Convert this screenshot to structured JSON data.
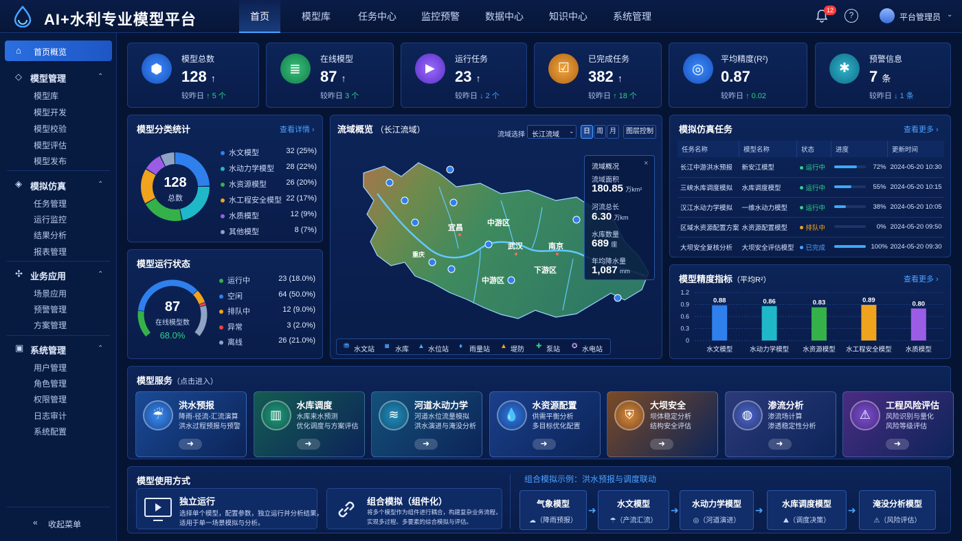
{
  "app": {
    "title": "AI+水利专业模型平台"
  },
  "nav": [
    "首页",
    "模型库",
    "任务中心",
    "监控预警",
    "数据中心",
    "知识中心",
    "系统管理"
  ],
  "header": {
    "notification_count": "12",
    "help": "?",
    "user": "平台管理员",
    "user_chevron": "⌄"
  },
  "sidebar": {
    "active": "首页概览",
    "groups": [
      {
        "label": "模型管理",
        "items": [
          "模型库",
          "模型开发",
          "模型校验",
          "模型评估",
          "模型发布"
        ]
      },
      {
        "label": "模拟仿真",
        "items": [
          "任务管理",
          "运行监控",
          "结果分析",
          "报表管理"
        ]
      },
      {
        "label": "业务应用",
        "items": [
          "场景应用",
          "预警管理",
          "方案管理"
        ]
      },
      {
        "label": "系统管理",
        "items": [
          "用户管理",
          "角色管理",
          "权限管理",
          "日志审计",
          "系统配置"
        ]
      }
    ],
    "collapse": "收起菜单"
  },
  "stats": [
    {
      "label": "模型总数",
      "value": "128",
      "cmp_label": "较昨日",
      "cmp": "↑ 5 个",
      "dir": "up"
    },
    {
      "label": "在线模型",
      "value": "87",
      "cmp_label": "较昨日",
      "cmp": "3 个",
      "dir": "up"
    },
    {
      "label": "运行任务",
      "value": "23",
      "cmp_label": "较昨日",
      "cmp": "↓ 2 个",
      "dir": "down"
    },
    {
      "label": "已完成任务",
      "value": "382",
      "cmp_label": "较昨日",
      "cmp": "↑ 18 个",
      "dir": "up"
    },
    {
      "label": "平均精度(R²)",
      "value": "0.87",
      "cmp_label": "较昨日",
      "cmp": "↑ 0.02",
      "dir": "up"
    },
    {
      "label": "预警信息",
      "value": "7",
      "unit": "条",
      "cmp_label": "较昨日",
      "cmp": "↓ 1 条",
      "dir": "down"
    }
  ],
  "category": {
    "title": "模型分类统计",
    "link": "查看详情 ›",
    "center_value": "128",
    "center_label": "总数",
    "items": [
      {
        "label": "水文模型",
        "value": "32 (25%)",
        "color": "#2f80ed"
      },
      {
        "label": "水动力学模型",
        "value": "28 (22%)",
        "color": "#1fb8c9"
      },
      {
        "label": "水资源模型",
        "value": "26 (20%)",
        "color": "#35b14a"
      },
      {
        "label": "水工程安全模型",
        "value": "22 (17%)",
        "color": "#f0a31c"
      },
      {
        "label": "水质模型",
        "value": "12 (9%)",
        "color": "#9b5de5"
      },
      {
        "label": "其他模型",
        "value": "8 (7%)",
        "color": "#8fa3c4"
      }
    ]
  },
  "run_status": {
    "title": "模型运行状态",
    "center_value": "87",
    "center_label": "在线模型数",
    "center_pct": "68.0%",
    "items": [
      {
        "label": "运行中",
        "value": "23 (18.0%)",
        "color": "#35b14a"
      },
      {
        "label": "空闲",
        "value": "64 (50.0%)",
        "color": "#2f80ed"
      },
      {
        "label": "排队中",
        "value": "12 (9.0%)",
        "color": "#f0a31c"
      },
      {
        "label": "异常",
        "value": "3 (2.0%)",
        "color": "#e84545"
      },
      {
        "label": "离线",
        "value": "26 (21.0%)",
        "color": "#8fa3c4"
      }
    ]
  },
  "basin": {
    "title": "流域概览",
    "subtitle": "（长江流域）",
    "select_label": "流域选择",
    "select_value": "长江流域",
    "periods": [
      "日",
      "周",
      "月"
    ],
    "layer_btn": "图层控制",
    "cities": [
      "宜昌",
      "中游区",
      "武汉",
      "南京",
      "重庆",
      "中游区",
      "下游区"
    ],
    "info": {
      "title": "流域概况",
      "close": "×",
      "rows": [
        {
          "label": "流域面积",
          "value": "180.85",
          "unit": "万km²"
        },
        {
          "label": "河流总长",
          "value": "6.30",
          "unit": "万km"
        },
        {
          "label": "水库数量",
          "value": "689",
          "unit": "座"
        },
        {
          "label": "年均降水量",
          "value": "1,087",
          "unit": "mm"
        }
      ]
    },
    "legend": [
      "水文站",
      "水库",
      "水位站",
      "雨量站",
      "堤防",
      "泵站",
      "水电站"
    ]
  },
  "sim": {
    "title": "模拟仿真任务",
    "link": "查看更多 ›",
    "columns": [
      "任务名称",
      "模型名称",
      "状态",
      "进度",
      "更新时间"
    ],
    "rows": [
      {
        "name": "长江中游洪水预报",
        "model": "新安江模型",
        "status": "运行中",
        "color": "#2fd18c",
        "progress": 72,
        "pct": "72%",
        "time": "2024-05-20 10:30"
      },
      {
        "name": "三峡水库调度模拟",
        "model": "水库调度模型",
        "status": "运行中",
        "color": "#2fd18c",
        "progress": 55,
        "pct": "55%",
        "time": "2024-05-20 10:15"
      },
      {
        "name": "汉江水动力学模拟",
        "model": "一维水动力模型",
        "status": "运行中",
        "color": "#2fd18c",
        "progress": 38,
        "pct": "38%",
        "time": "2024-05-20 10:05"
      },
      {
        "name": "区域水资源配置方案",
        "model": "水资源配置模型",
        "status": "排队中",
        "color": "#f0a31c",
        "progress": 0,
        "pct": "0%",
        "time": "2024-05-20 09:50"
      },
      {
        "name": "大坝安全复核分析",
        "model": "大坝安全评估模型",
        "status": "已完成",
        "color": "#4aa3ff",
        "progress": 100,
        "pct": "100%",
        "time": "2024-05-20 09:30"
      }
    ]
  },
  "chart_data": {
    "type": "bar",
    "title": "模型精度指标",
    "subtitle": "（平均R²）",
    "link": "查看更多 ›",
    "categories": [
      "水文模型",
      "水动力学模型",
      "水资源模型",
      "水工程安全模型",
      "水质模型"
    ],
    "values": [
      0.88,
      0.86,
      0.83,
      0.89,
      0.8
    ],
    "labels": [
      "0.88",
      "0.86",
      "0.83",
      "0.89",
      "0.80"
    ],
    "colors": [
      "#2f80ed",
      "#1fb8c9",
      "#35b14a",
      "#f0a31c",
      "#9b5de5"
    ],
    "yticks": [
      "1.2",
      "0.9",
      "0.6",
      "0.3",
      "0"
    ],
    "ylim": [
      0,
      1.2
    ]
  },
  "services": {
    "title": "模型服务",
    "hint": "（点击进入）",
    "items": [
      {
        "title": "洪水预报",
        "desc1": "降雨-径流-汇流演算",
        "desc2": "洪水过程预报与预警",
        "bg": "#1a4a96",
        "ic": "#3b8cf0"
      },
      {
        "title": "水库调度",
        "desc1": "水库来水预测",
        "desc2": "优化调度与方案评估",
        "bg": "#145b52",
        "ic": "#1f9a7a"
      },
      {
        "title": "河道水动力学",
        "desc1": "河道水位流量模拟",
        "desc2": "洪水演进与淹没分析",
        "bg": "#14517a",
        "ic": "#1f8fb8"
      },
      {
        "title": "水资源配置",
        "desc1": "供需平衡分析",
        "desc2": "多目标优化配置",
        "bg": "#1a3f8a",
        "ic": "#2f7ae0"
      },
      {
        "title": "大坝安全",
        "desc1": "坝体稳定分析",
        "desc2": "结构安全评估",
        "bg": "#7a4a26",
        "ic": "#d88a3a"
      },
      {
        "title": "渗流分析",
        "desc1": "渗流场计算",
        "desc2": "渗透稳定性分析",
        "bg": "#2c3a7a",
        "ic": "#4a66c8"
      },
      {
        "title": "工程风险评估",
        "desc1": "风险识别与量化",
        "desc2": "风险等级评估",
        "bg": "#4a2c82",
        "ic": "#7b4fd0"
      }
    ],
    "arrow": "➜"
  },
  "usage": {
    "title": "模型使用方式",
    "cards": [
      {
        "title": "独立运行",
        "desc1": "选择单个模型，配置参数，独立运行并分析结果，",
        "desc2": "适用于单一场景模拟与分析。"
      },
      {
        "title": "组合模拟（组件化）",
        "desc1": "将多个模型作为组件进行耦合，构建复杂业务流程，",
        "desc2": "实现多过程、多要素的综合模拟与评估。"
      }
    ],
    "example_title": "组合模拟示例：洪水预报与调度联动",
    "flow": [
      {
        "title": "气象模型",
        "sub": "（降雨预报）",
        "icon": "☁"
      },
      {
        "title": "水文模型",
        "sub": "（产流汇流）",
        "icon": "☂"
      },
      {
        "title": "水动力学模型",
        "sub": "（河道演进）",
        "icon": "◎"
      },
      {
        "title": "水库调度模型",
        "sub": "（调度决策）",
        "icon": "⛰"
      },
      {
        "title": "淹没分析模型",
        "sub": "（风险评估）",
        "icon": "⚠"
      }
    ]
  }
}
